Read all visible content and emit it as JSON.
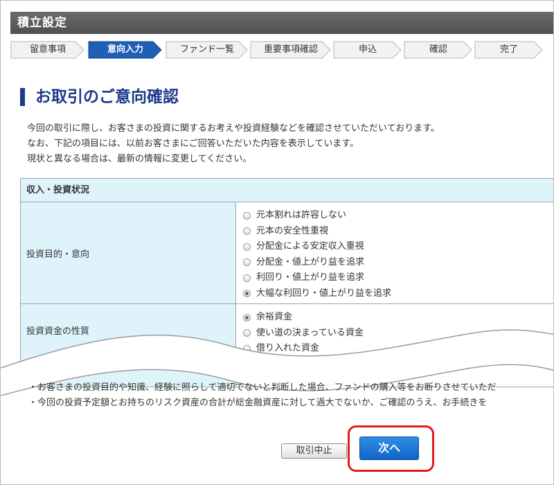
{
  "header": {
    "title": "積立設定"
  },
  "steps": [
    {
      "label": "留意事項",
      "active": false
    },
    {
      "label": "意向入力",
      "active": true
    },
    {
      "label": "ファンド一覧",
      "active": false
    },
    {
      "label": "重要事項確認",
      "active": false
    },
    {
      "label": "申込",
      "active": false
    },
    {
      "label": "確認",
      "active": false
    },
    {
      "label": "完了",
      "active": false
    }
  ],
  "page": {
    "title": "お取引のご意向確認",
    "intro": [
      "今回の取引に際し、お客さまの投資に関するお考えや投資経験などを確認させていただいております。",
      "なお、下記の項目には、以前お客さまにご回答いただいた内容を表示しています。",
      "現状と異なる場合は、最新の情報に変更してください。"
    ]
  },
  "table": {
    "section_header": "収入・投資状況",
    "rows": [
      {
        "label": "投資目的・意向",
        "options": [
          {
            "text": "元本割れは許容しない",
            "checked": false
          },
          {
            "text": "元本の安全性重視",
            "checked": false
          },
          {
            "text": "分配金による安定収入重視",
            "checked": false
          },
          {
            "text": "分配金・値上がり益を追求",
            "checked": false
          },
          {
            "text": "利回り・値上がり益を追求",
            "checked": false
          },
          {
            "text": "大幅な利回り・値上がり益を追求",
            "checked": true
          }
        ]
      },
      {
        "label": "投資資金の性質",
        "options": [
          {
            "text": "余裕資金",
            "checked": true
          },
          {
            "text": "使い道の決まっている資金",
            "checked": false
          },
          {
            "text": "借り入れた資金",
            "checked": false
          }
        ]
      }
    ]
  },
  "notes": [
    "・お客さまの投資目的や知識、経験に照らして適切でないと判断した場合、ファンドの購入等をお断りさせていただ",
    "・今回の投資予定額とお持ちのリスク資産の合計が総金融資産に対して過大でないか、ご確認のうえ、お手続きを"
  ],
  "buttons": {
    "cancel": "取引中止",
    "next": "次へ"
  },
  "colors": {
    "header_bg": "#585858",
    "step_active": "#1f5fb5",
    "title": "#1b3a8a",
    "table_label_bg": "#dff3fb",
    "next_button": "#1a72d8",
    "highlight": "#e21b1b"
  }
}
